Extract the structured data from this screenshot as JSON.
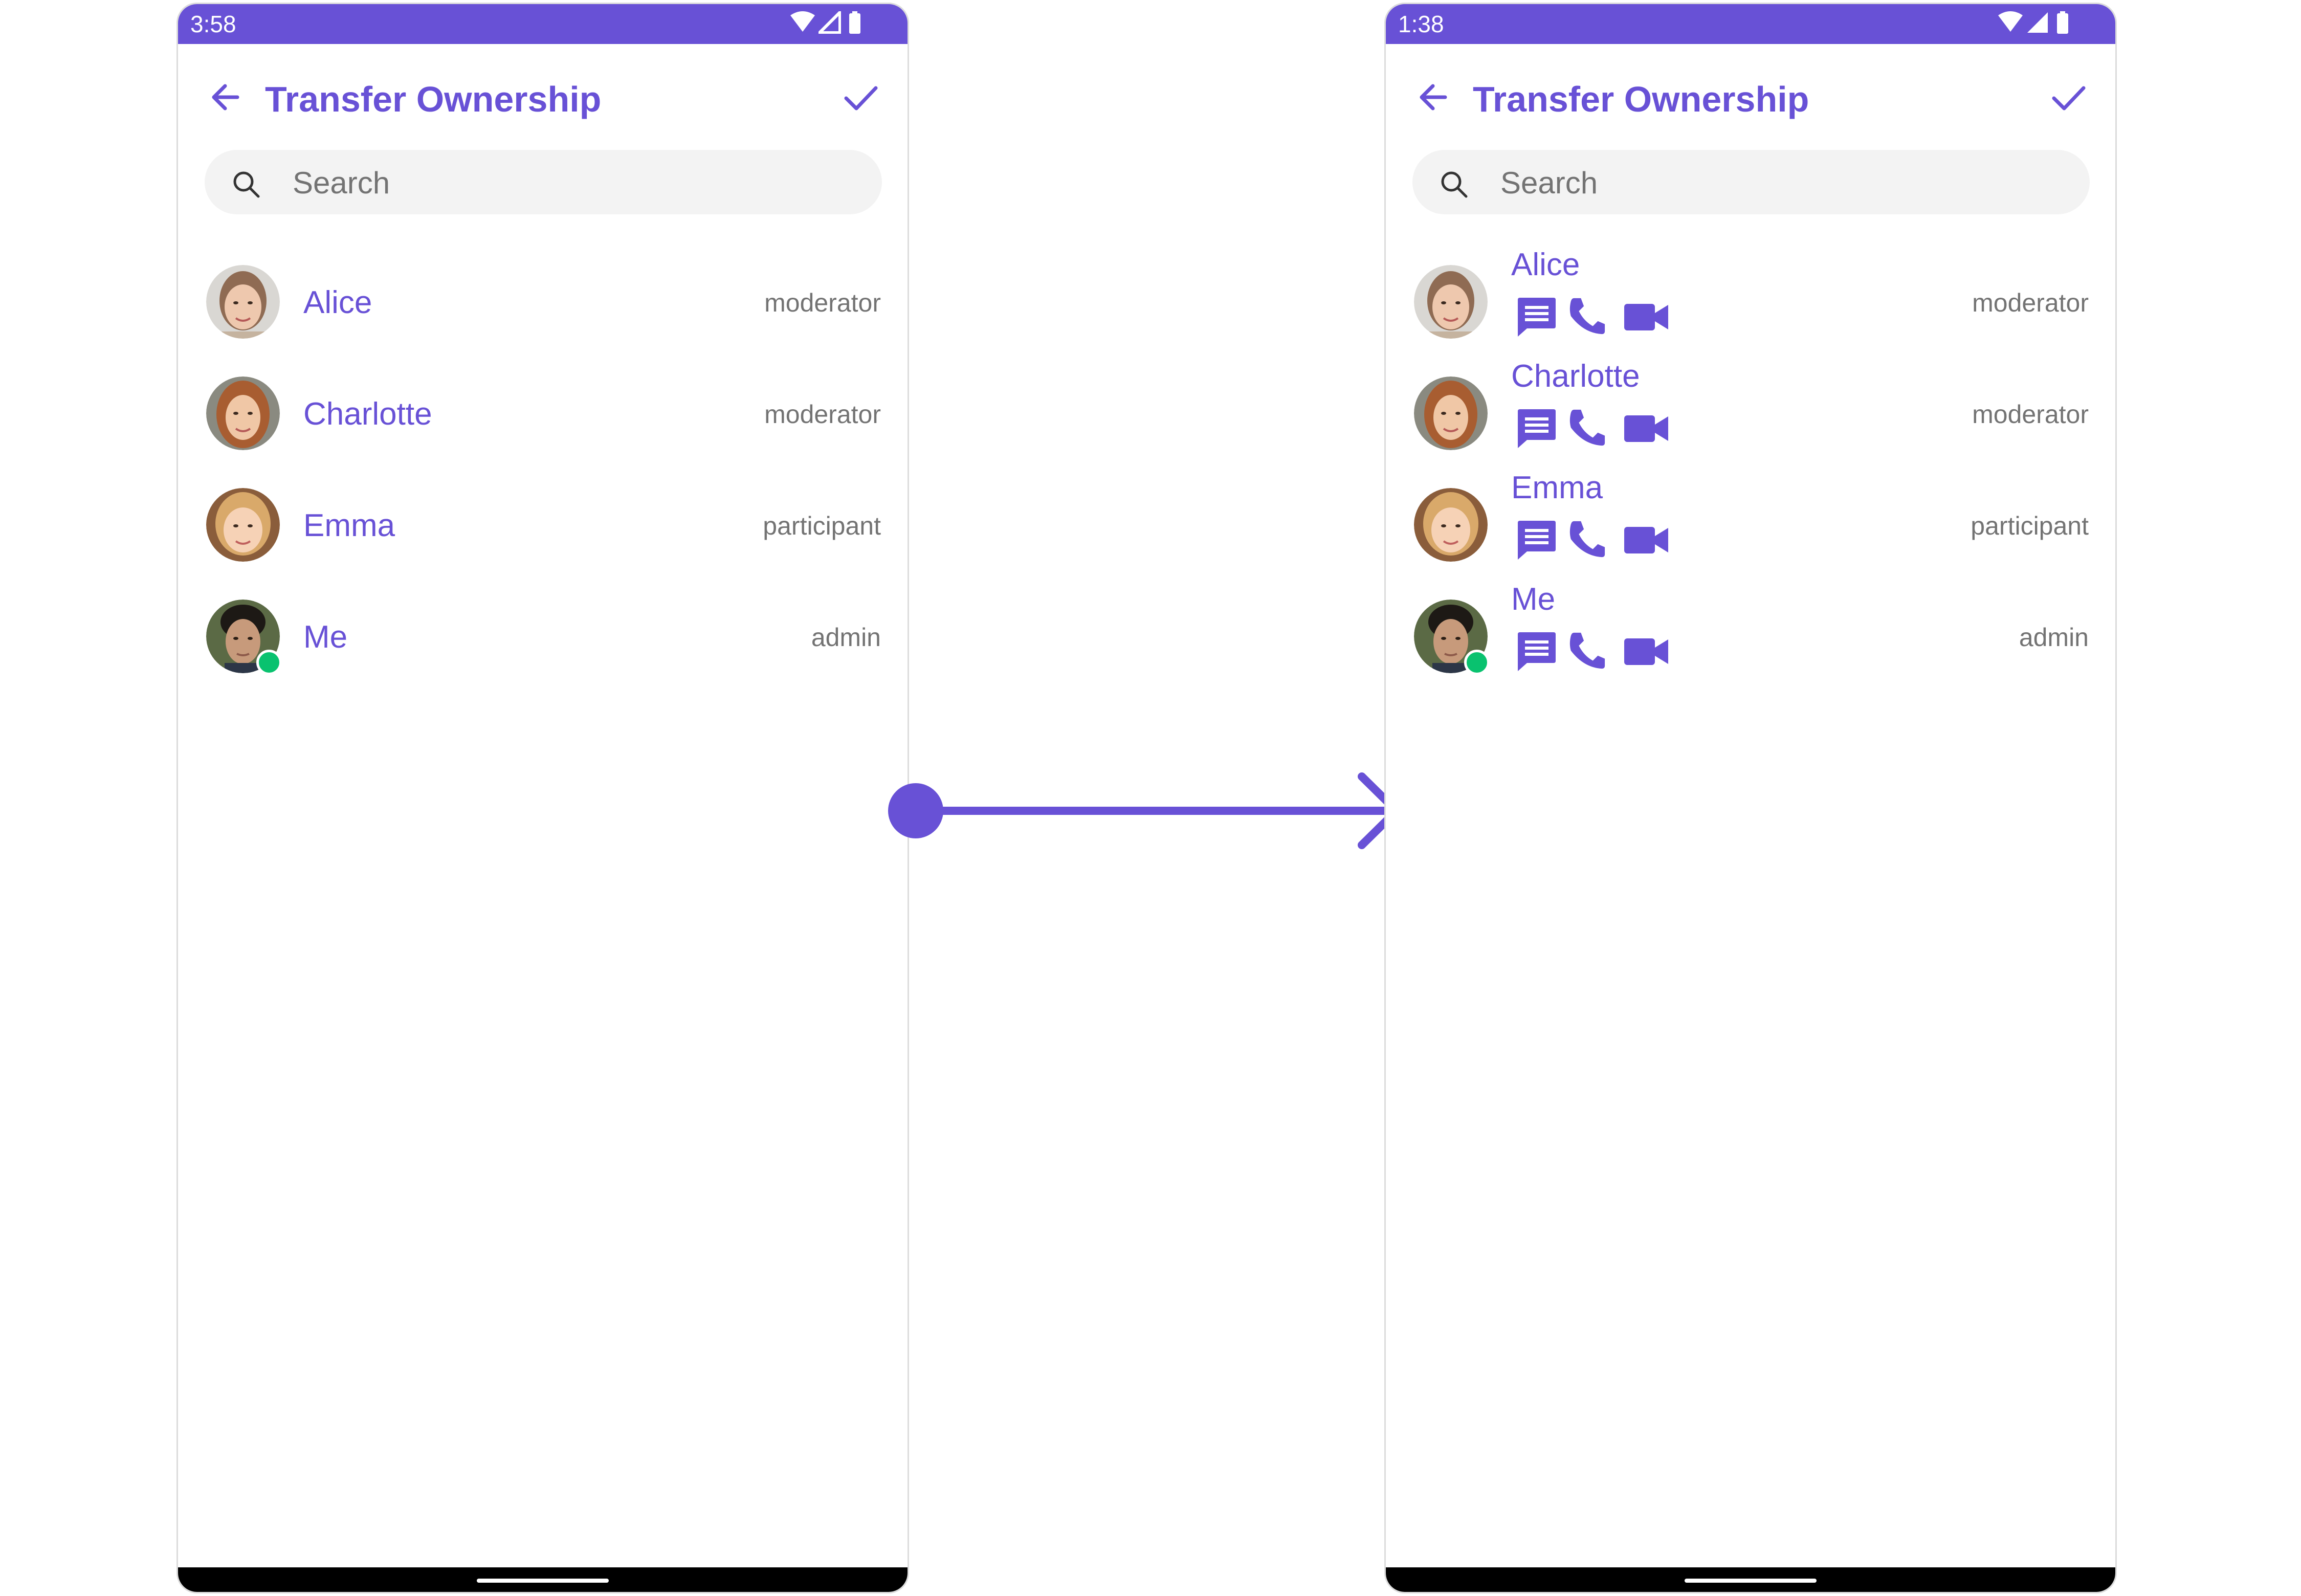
{
  "theme": {
    "accent": "#6851d6",
    "secondary_text": "#737373",
    "search_bg": "#f3f3f3",
    "online_status": "#09c26f"
  },
  "before": {
    "status_bar": {
      "time": "3:58",
      "icons": [
        "wifi-icon",
        "signal-icon",
        "battery-icon"
      ]
    },
    "app_bar": {
      "title": "Transfer Ownership",
      "back_icon": "arrow-back-icon",
      "done_icon": "check-icon"
    },
    "search": {
      "placeholder": "Search",
      "value": ""
    },
    "members": [
      {
        "name": "Alice",
        "role": "moderator",
        "online": false
      },
      {
        "name": "Charlotte",
        "role": "moderator",
        "online": false
      },
      {
        "name": "Emma",
        "role": "participant",
        "online": false
      },
      {
        "name": "Me",
        "role": "admin",
        "online": true
      }
    ]
  },
  "after": {
    "status_bar": {
      "time": "1:38",
      "icons": [
        "wifi-icon",
        "signal-icon",
        "battery-icon"
      ]
    },
    "app_bar": {
      "title": "Transfer Ownership",
      "back_icon": "arrow-back-icon",
      "done_icon": "check-icon"
    },
    "search": {
      "placeholder": "Search",
      "value": ""
    },
    "members": [
      {
        "name": "Alice",
        "role": "moderator",
        "online": false
      },
      {
        "name": "Charlotte",
        "role": "moderator",
        "online": false
      },
      {
        "name": "Emma",
        "role": "participant",
        "online": false
      },
      {
        "name": "Me",
        "role": "admin",
        "online": true
      }
    ],
    "member_action_icons": [
      "message-icon",
      "phone-icon",
      "video-icon"
    ]
  },
  "transition_icon": "arrow-right-icon"
}
